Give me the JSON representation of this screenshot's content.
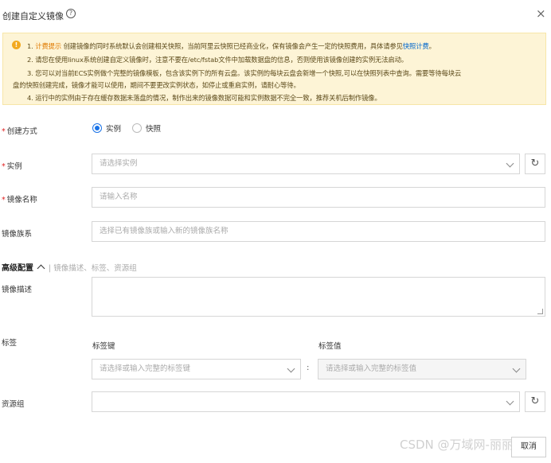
{
  "header": {
    "title": "创建自定义镜像",
    "help_icon": "?",
    "close_icon": "×"
  },
  "notice": {
    "icon": "!",
    "line1_prefix": "1. ",
    "line1_tag": "计费提示",
    "line1_text": " 创建镜像的同时系统默认会创建相关快照，当前阿里云快照已经商业化，保有镜像会产生一定的快照费用，具体请参见",
    "line1_link": "快照计费",
    "line1_end": "。",
    "line2": "2. 请您在使用linux系统创建自定义镜像时，注意不要在/etc/fstab文件中加载数据盘的信息，否则使用该镜像创建的实例无法启动。",
    "line3": "3. 您可以对当前ECS实例做个完整的镜像模板，包含该实例下的所有云盘。该实例的每块云盘会新增一个快照,可以在快照列表中查询。需要等待每块云",
    "line3b": "盘的快照创建完成，镜像才能可以使用，期间不要更改实例状态，如停止或重启实例，请耐心等待。",
    "line4": "4. 运行中的实例由于存在缓存数据未落盘的情况，制作出来的镜像数据可能和实例数据不完全一致，推荐关机后制作镜像。"
  },
  "form": {
    "create_method": {
      "label": "创建方式",
      "required": "*",
      "options": [
        "实例",
        "快照"
      ],
      "selected": "实例"
    },
    "instance": {
      "label": "实例",
      "required": "*",
      "placeholder": "请选择实例"
    },
    "image_name": {
      "label": "镜像名称",
      "required": "*",
      "placeholder": "请输入名称"
    },
    "image_family": {
      "label": "镜像族系",
      "placeholder": "选择已有镜像族或输入新的镜像族名称"
    },
    "advanced": {
      "label": "高级配置",
      "sub": "| 镜像描述、标签、资源组"
    },
    "description": {
      "label": "镜像描述"
    },
    "tags": {
      "label": "标签",
      "key_label": "标签键",
      "value_label": "标签值",
      "key_placeholder": "请选择或输入完整的标签键",
      "value_placeholder": "请选择或输入完整的标签值",
      "separator": ":"
    },
    "resource_group": {
      "label": "资源组"
    }
  },
  "footer": {
    "watermark": "CSDN @万域网-丽丽",
    "button_label": "取消"
  },
  "icons": {
    "refresh": "↻"
  }
}
